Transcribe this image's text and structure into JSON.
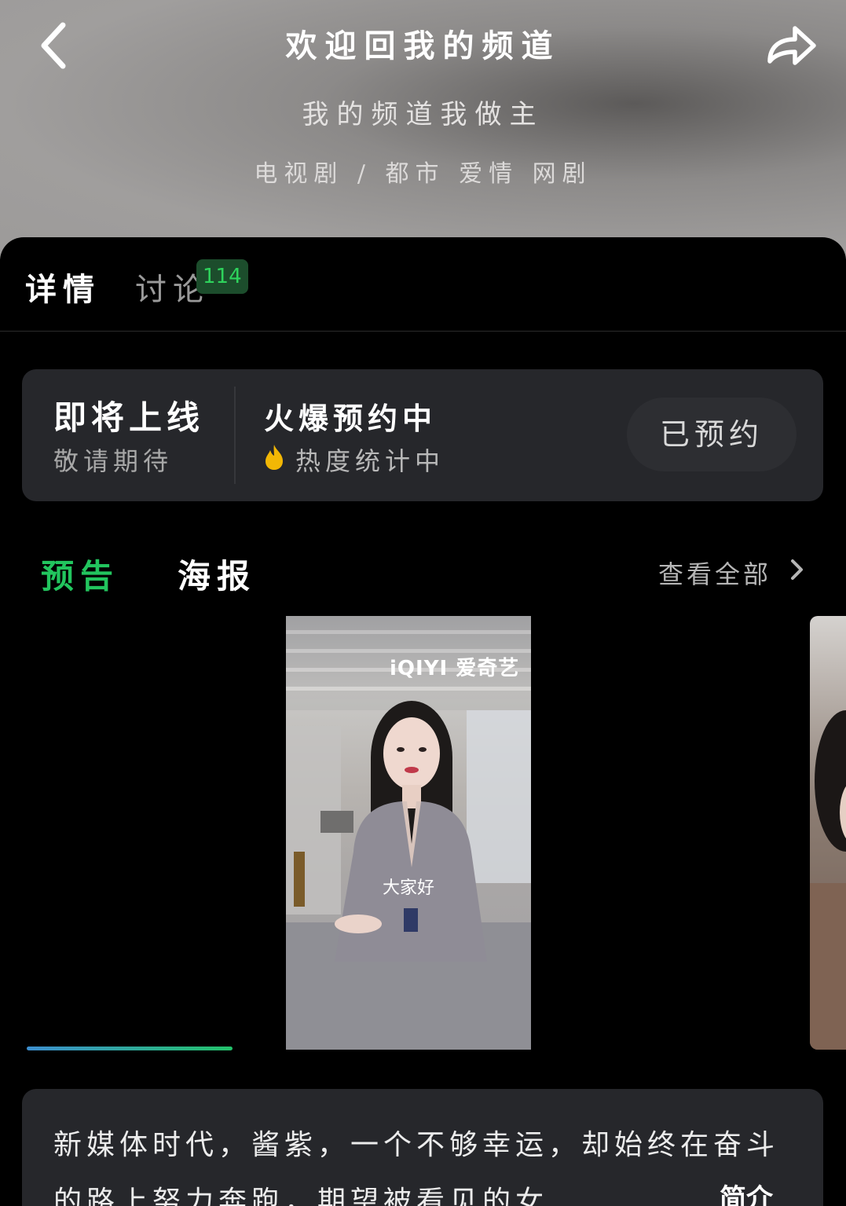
{
  "header": {
    "title": "欢迎回我的频道",
    "subtitle": "我的频道我做主",
    "genres": "电视剧 / 都市 爱情 网剧"
  },
  "tabs": {
    "details_label": "详情",
    "discuss_label": "讨论",
    "discuss_count": "114"
  },
  "status": {
    "title": "即将上线",
    "subtitle": "敬请期待",
    "hot_title": "火爆预约中",
    "hot_subtitle": "热度统计中",
    "reserve_label": "已预约"
  },
  "media": {
    "trailer_tab": "预告",
    "poster_tab": "海报",
    "view_all": "查看全部",
    "video": {
      "brand": "iQIYI 爱奇艺",
      "caption": "大家好"
    }
  },
  "synopsis": {
    "text": "新媒体时代，酱紫，一个不够幸运，却始终在奋斗的路上努力奔跑，期望被看见的女",
    "more_label": "简介"
  },
  "colors": {
    "accent_green": "#22c55e",
    "badge_green": "#2ed35c",
    "card_bg": "#26272b"
  }
}
